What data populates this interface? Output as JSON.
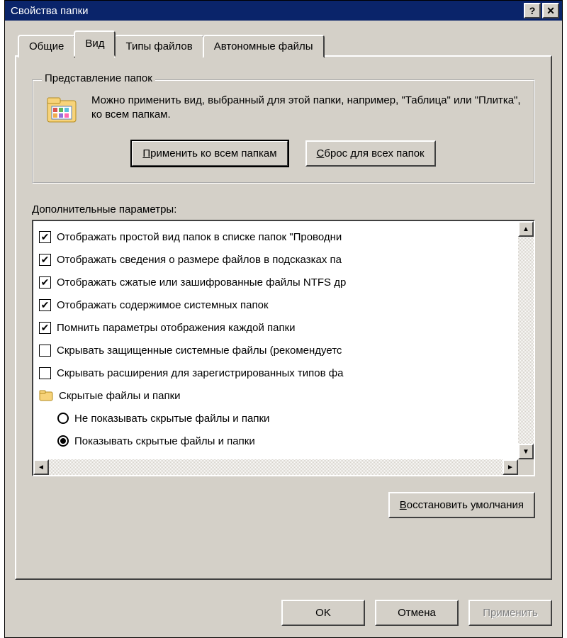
{
  "window": {
    "title": "Свойства папки"
  },
  "tabs": [
    {
      "label": "Общие"
    },
    {
      "label": "Вид"
    },
    {
      "label": "Типы файлов"
    },
    {
      "label": "Автономные файлы"
    }
  ],
  "active_tab": 1,
  "view_group": {
    "legend": "Представление папок",
    "description": "Можно применить вид, выбранный для этой папки, например, \"Таблица\" или \"Плитка\", ко всем папкам.",
    "apply_label_pre": "",
    "apply_ul": "П",
    "apply_label_post": "рименить ко всем папкам",
    "reset_ul": "С",
    "reset_label_post": "брос для всех папок"
  },
  "advanced": {
    "label": "Дополнительные параметры:",
    "items": [
      {
        "type": "checkbox",
        "checked": true,
        "text": "Отображать простой вид папок в списке папок \"Проводни"
      },
      {
        "type": "checkbox",
        "checked": true,
        "text": "Отображать сведения о размере файлов в подсказках па"
      },
      {
        "type": "checkbox",
        "checked": true,
        "text": "Отображать сжатые или зашифрованные файлы NTFS др"
      },
      {
        "type": "checkbox",
        "checked": true,
        "text": "Отображать содержимое системных папок"
      },
      {
        "type": "checkbox",
        "checked": true,
        "text": "Помнить параметры отображения каждой папки"
      },
      {
        "type": "checkbox",
        "checked": false,
        "text": "Скрывать защищенные системные файлы (рекомендуетс"
      },
      {
        "type": "checkbox",
        "checked": false,
        "text": "Скрывать расширения для зарегистрированных типов фа"
      },
      {
        "type": "folder",
        "text": "Скрытые файлы и папки"
      },
      {
        "type": "radio",
        "checked": false,
        "indent": true,
        "text": "Не показывать скрытые файлы и папки"
      },
      {
        "type": "radio",
        "checked": true,
        "indent": true,
        "text": "Показывать скрытые файлы и папки"
      }
    ]
  },
  "restore_ul": "В",
  "restore_post": "осстановить умолчания",
  "buttons": {
    "ok": "OK",
    "cancel": "Отмена",
    "apply_pre": "П",
    "apply_ul": "р",
    "apply_post": "именить"
  }
}
